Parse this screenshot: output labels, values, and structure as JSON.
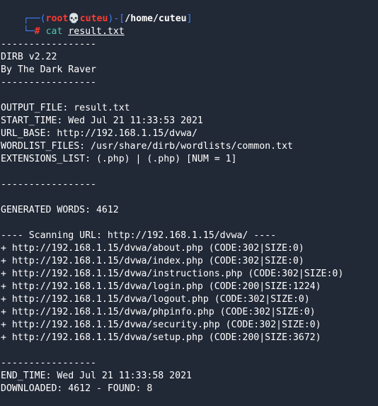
{
  "prompt": {
    "corner_top": "┌──(",
    "user": "root",
    "skull": "💀",
    "host": "cuteu",
    "mid": ")-[",
    "path": "/home/cuteu",
    "end": "]",
    "corner_bottom": "└─",
    "hash": "#",
    "command": "cat",
    "argument": "result.txt"
  },
  "output": [
    "",
    "-----------------",
    "DIRB v2.22",
    "By The Dark Raver",
    "-----------------",
    "",
    "OUTPUT_FILE: result.txt",
    "START_TIME: Wed Jul 21 11:33:53 2021",
    "URL_BASE: http://192.168.1.15/dvwa/",
    "WORDLIST_FILES: /usr/share/dirb/wordlists/common.txt",
    "EXTENSIONS_LIST: (.php) | (.php) [NUM = 1]",
    "",
    "-----------------",
    "",
    "GENERATED WORDS: 4612",
    "",
    "---- Scanning URL: http://192.168.1.15/dvwa/ ----",
    "+ http://192.168.1.15/dvwa/about.php (CODE:302|SIZE:0)",
    "+ http://192.168.1.15/dvwa/index.php (CODE:302|SIZE:0)",
    "+ http://192.168.1.15/dvwa/instructions.php (CODE:302|SIZE:0)",
    "+ http://192.168.1.15/dvwa/login.php (CODE:200|SIZE:1224)",
    "+ http://192.168.1.15/dvwa/logout.php (CODE:302|SIZE:0)",
    "+ http://192.168.1.15/dvwa/phpinfo.php (CODE:302|SIZE:0)",
    "+ http://192.168.1.15/dvwa/security.php (CODE:302|SIZE:0)",
    "+ http://192.168.1.15/dvwa/setup.php (CODE:200|SIZE:3672)",
    "",
    "-----------------",
    "END_TIME: Wed Jul 21 11:33:58 2021",
    "DOWNLOADED: 4612 - FOUND: 8"
  ]
}
